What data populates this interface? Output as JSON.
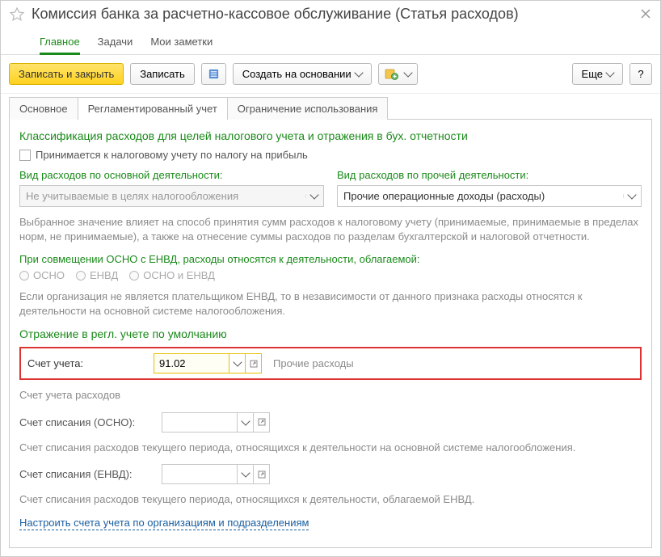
{
  "header": {
    "title": "Комиссия банка за расчетно-кассовое обслуживание (Статья расходов)"
  },
  "nav": {
    "main": "Главное",
    "tasks": "Задачи",
    "notes": "Мои заметки"
  },
  "toolbar": {
    "save_close": "Записать и закрыть",
    "save": "Записать",
    "create_based": "Создать на основании",
    "more": "Еще",
    "help": "?"
  },
  "tabs": {
    "t1": "Основное",
    "t2": "Регламентированный учет",
    "t3": "Ограничение использования"
  },
  "panel": {
    "section1_title": "Классификация расходов для целей налогового учета и отражения в бух. отчетности",
    "accept_tax": "Принимается к налоговому учету по налогу на прибыль",
    "main_activity_label": "Вид расходов по основной деятельности:",
    "main_activity_value": "Не учитываемые в целях налогообложения",
    "other_activity_label": "Вид расходов по прочей деятельности:",
    "other_activity_value": "Прочие операционные доходы (расходы)",
    "info1": "Выбранное значение влияет на способ принятия сумм расходов к налоговому учету (принимаемые, принимаемые в пределах норм, не принимаемые), а также на отнесение суммы расходов по разделам бухгалтерской и налоговой отчетности.",
    "osno_enb_label": "При совмещении ОСНО с ЕНВД, расходы относятся к деятельности, облагаемой:",
    "r1": "ОСНО",
    "r2": "ЕНВД",
    "r3": "ОСНО и ЕНВД",
    "info2": "Если организация не является плательщиком ЕНВД, то в независимости от данного признака расходы относятся к деятельности на основной системе налогообложения.",
    "section2_title": "Отражение в регл. учете по умолчанию",
    "account_label": "Счет учета:",
    "account_value": "91.02",
    "account_side": "Прочие расходы",
    "acct_exp_info": "Счет учета расходов",
    "writeoff_osno_label": "Счет списания (ОСНО):",
    "writeoff_osno_info": "Счет списания расходов текущего периода, относящихся к деятельности на основной системе налогообложения.",
    "writeoff_envd_label": "Счет списания (ЕНВД):",
    "writeoff_envd_info": "Счет списания расходов текущего периода, относящихся к деятельности, облагаемой ЕНВД.",
    "config_link": "Настроить счета учета по организациям и подразделениям"
  }
}
